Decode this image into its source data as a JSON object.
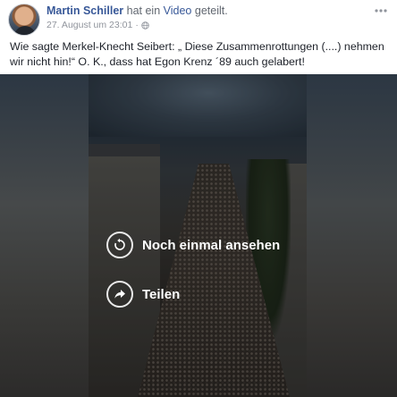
{
  "post": {
    "author": "Martin Schiller",
    "action_prefix": "hat ein",
    "action_link": "Video",
    "action_suffix": "geteilt.",
    "timestamp": "27. August um 23:01",
    "privacy_icon": "globe-icon",
    "options_icon": "more-options-icon",
    "text": "Wie sagte Merkel-Knecht Seibert: „ Diese Zusammenrottungen (....) nehmen wir nicht hin!“ O. K., dass hat Egon Krenz ´89 auch gelabert!"
  },
  "video": {
    "replay_label": "Noch einmal ansehen",
    "replay_icon": "replay-icon",
    "share_label": "Teilen",
    "share_icon": "share-arrow-icon"
  },
  "colors": {
    "link": "#385898",
    "meta": "#90949c",
    "text": "#1d2129"
  }
}
